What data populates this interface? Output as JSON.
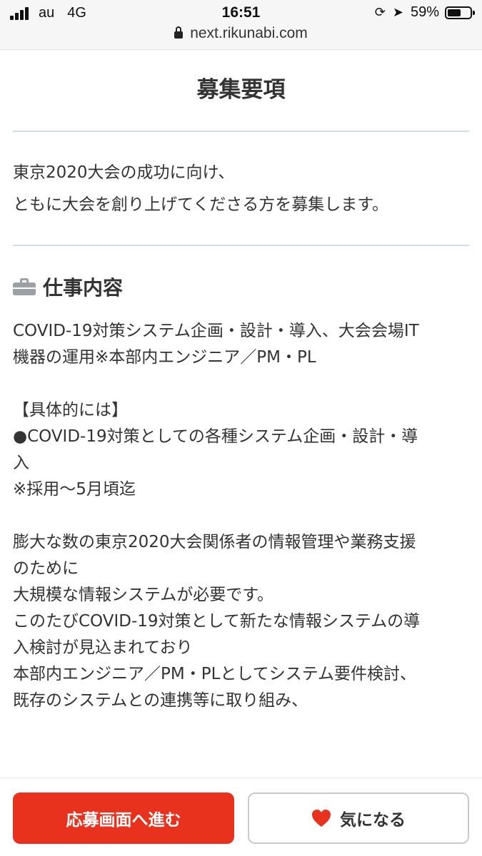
{
  "status_bar": {
    "carrier": "au",
    "network": "4G",
    "time": "16:51",
    "battery_percent": "59%",
    "battery_level": 0.59
  },
  "browser": {
    "url": "next.rikunabi.com"
  },
  "page": {
    "title": "募集要項",
    "intro_lines": [
      "東京2020大会の成功に向け、",
      "ともに大会を創り上げてくださる方を募集します。"
    ],
    "section_title": "仕事内容",
    "body_lines": [
      "COVID-19対策システム企画・設計・導入、大会会場IT",
      "機器の運用※本部内エンジニア／PM・PL",
      "",
      "【具体的には】",
      "●COVID-19対策としての各種システム企画・設計・導",
      "入",
      "※採用～5月頃迄",
      "",
      "膨大な数の東京2020大会関係者の情報管理や業務支援",
      "のために",
      "大規模な情報システムが必要です。",
      "このたびCOVID-19対策として新たな情報システムの導",
      "入検討が見込まれており",
      "本部内エンジニア／PM・PLとしてシステム要件検討、",
      "既存のシステムとの連携等に取り組み、"
    ]
  },
  "actions": {
    "apply_label": "応募画面へ進む",
    "favorite_label": "気になる"
  },
  "colors": {
    "apply_button": "#e8321e",
    "heart": "#e8321e",
    "divider": "#d3dbe3"
  }
}
